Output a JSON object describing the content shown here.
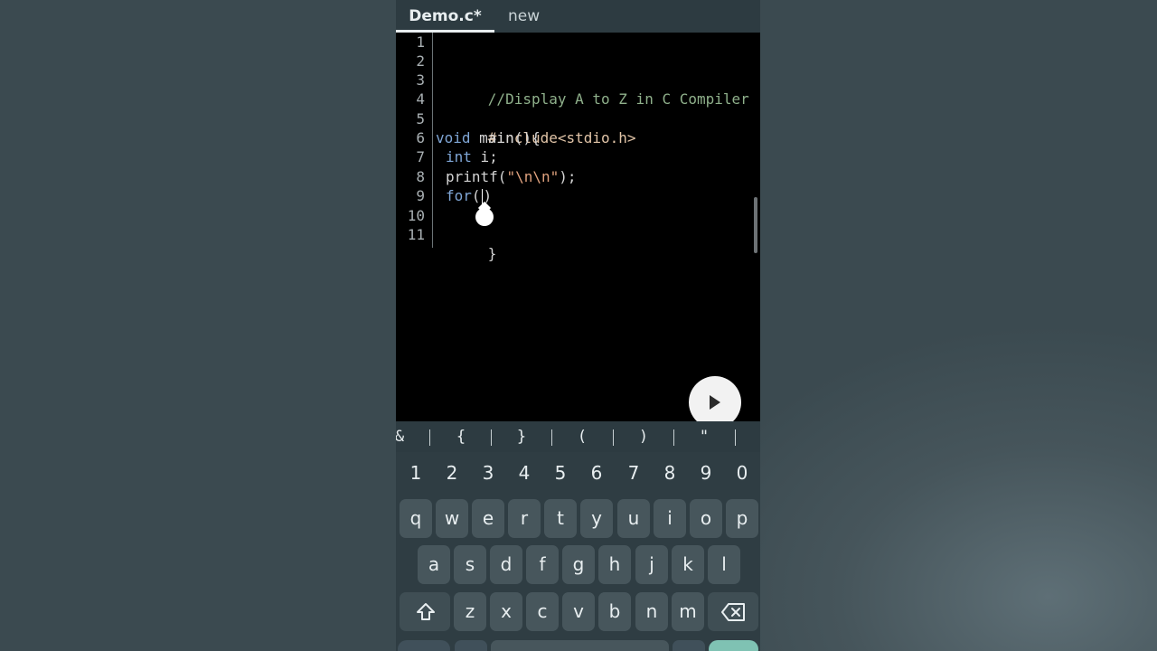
{
  "tabs": [
    {
      "label": "Demo.c*",
      "active": true
    },
    {
      "label": "new",
      "active": false
    }
  ],
  "editor": {
    "line_numbers": [
      "1",
      "2",
      "3",
      "4",
      "5",
      "6",
      "7",
      "8",
      "9",
      "10",
      "11"
    ],
    "lines": {
      "l3": {
        "comment": "//Display A to Z in C Compiler"
      },
      "l5": {
        "pre": "#include<stdio.h>"
      },
      "l6": {
        "kw": "void",
        "rest": " main(){"
      },
      "l7": {
        "kw": "int",
        "rest": " i;"
      },
      "l8": {
        "fn": "printf(",
        "str": "\"\\n\\n\"",
        "end": ");"
      },
      "l9": {
        "kw": "for",
        "open": "(",
        "close": ")"
      },
      "l11": {
        "text": "}"
      }
    }
  },
  "symbol_bar": [
    "&",
    "{",
    "}",
    "(",
    ")",
    "\""
  ],
  "keyboard": {
    "numbers": [
      "1",
      "2",
      "3",
      "4",
      "5",
      "6",
      "7",
      "8",
      "9",
      "0"
    ],
    "row1": [
      "q",
      "w",
      "e",
      "r",
      "t",
      "y",
      "u",
      "i",
      "o",
      "p"
    ],
    "row2": [
      "a",
      "s",
      "d",
      "f",
      "g",
      "h",
      "j",
      "k",
      "l"
    ],
    "row3": [
      "z",
      "x",
      "c",
      "v",
      "b",
      "n",
      "m"
    ]
  },
  "colors": {
    "background": "#3d4b51",
    "tab_bar": "#2d3b41",
    "editor_bg": "#000000",
    "comment": "#8fb08b",
    "keyword": "#7fa6d6",
    "string": "#e0a27e",
    "preprocessor": "#e1c4a7",
    "enter_key": "#7fc2b3"
  },
  "icons": {
    "run": "play-icon",
    "shift": "shift-arrow-icon",
    "backspace": "backspace-icon"
  }
}
